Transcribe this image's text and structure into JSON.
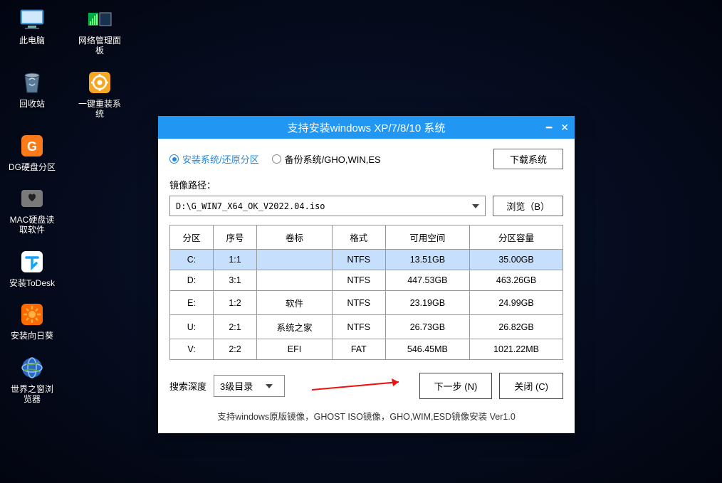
{
  "desktop": {
    "icons": [
      {
        "label": "此电脑",
        "row": 0
      },
      {
        "label": "网络管理面板",
        "row": 0
      },
      {
        "label": "回收站",
        "row": 1
      },
      {
        "label": "一键重装系统",
        "row": 1
      },
      {
        "label": "DG硬盘分区",
        "row": 2
      },
      {
        "label": "MAC硬盘读取软件",
        "row": 3
      },
      {
        "label": "安装ToDesk",
        "row": 4
      },
      {
        "label": "安装向日葵",
        "row": 5
      },
      {
        "label": "世界之窗浏览器",
        "row": 6
      }
    ]
  },
  "dialog": {
    "title": "支持安装windows XP/7/8/10 系统",
    "option_install": "安装系统/还原分区",
    "option_backup": "备份系统/GHO,WIN,ES",
    "download_btn": "下载系统",
    "path_label": "镜像路径：",
    "path_value": "D:\\G_WIN7_X64_OK_V2022.04.iso",
    "browse_btn": "浏览（B）",
    "columns": [
      "分区",
      "序号",
      "卷标",
      "格式",
      "可用空间",
      "分区容量"
    ],
    "rows": [
      {
        "part": "C:",
        "idx": "1:1",
        "vol": "",
        "fmt": "NTFS",
        "free": "13.51GB",
        "total": "35.00GB",
        "selected": true
      },
      {
        "part": "D:",
        "idx": "3:1",
        "vol": "",
        "fmt": "NTFS",
        "free": "447.53GB",
        "total": "463.26GB"
      },
      {
        "part": "E:",
        "idx": "1:2",
        "vol": "软件",
        "fmt": "NTFS",
        "free": "23.19GB",
        "total": "24.99GB"
      },
      {
        "part": "U:",
        "idx": "2:1",
        "vol": "系统之家",
        "fmt": "NTFS",
        "free": "26.73GB",
        "total": "26.82GB"
      },
      {
        "part": "V:",
        "idx": "2:2",
        "vol": "EFI",
        "fmt": "FAT",
        "free": "546.45MB",
        "total": "1021.22MB"
      }
    ],
    "depth_label": "搜索深度",
    "depth_value": "3级目录",
    "next_btn": "下一步 (N)",
    "close_btn": "关闭 (C)",
    "footer": "支持windows原版镜像，GHOST ISO镜像，GHO,WIM,ESD镜像安装 Ver1.0"
  }
}
